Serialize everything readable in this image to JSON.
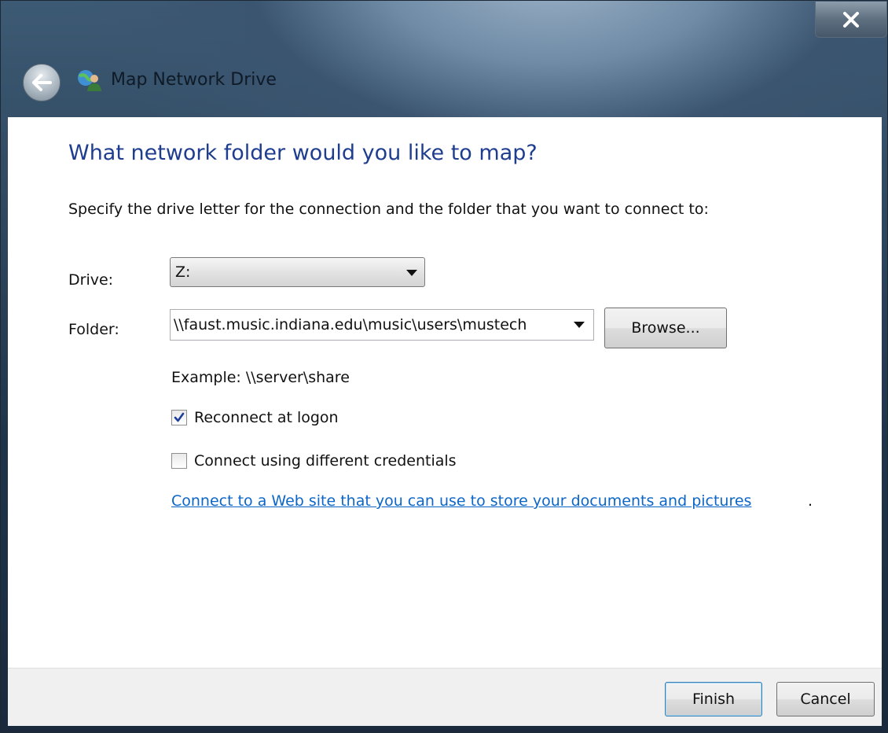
{
  "window": {
    "title": "Map Network Drive",
    "close_label": "X"
  },
  "main": {
    "heading": "What network folder would you like to map?",
    "instruction": "Specify the drive letter for the connection and the folder that you want to connect to:",
    "drive": {
      "label": "Drive:",
      "value": "Z:"
    },
    "folder": {
      "label": "Folder:",
      "value": "\\\\faust.music.indiana.edu\\music\\users\\mustech",
      "browse_label": "Browse..."
    },
    "example": "Example: \\\\server\\share",
    "reconnect": {
      "label": "Reconnect at logon",
      "checked": true
    },
    "different_credentials": {
      "label": "Connect using different credentials",
      "checked": false
    },
    "web_link": "Connect to a Web site that you can use to store your documents and pictures",
    "web_link_suffix": "."
  },
  "footer": {
    "finish_label": "Finish",
    "cancel_label": "Cancel"
  },
  "colors": {
    "heading": "#1e3d8f",
    "link": "#0b66c8"
  },
  "icons": {
    "back": "back-arrow-icon",
    "title": "network-drive-icon",
    "close": "close-icon",
    "dropdown": "chevron-down-icon",
    "check": "checkmark-icon"
  }
}
